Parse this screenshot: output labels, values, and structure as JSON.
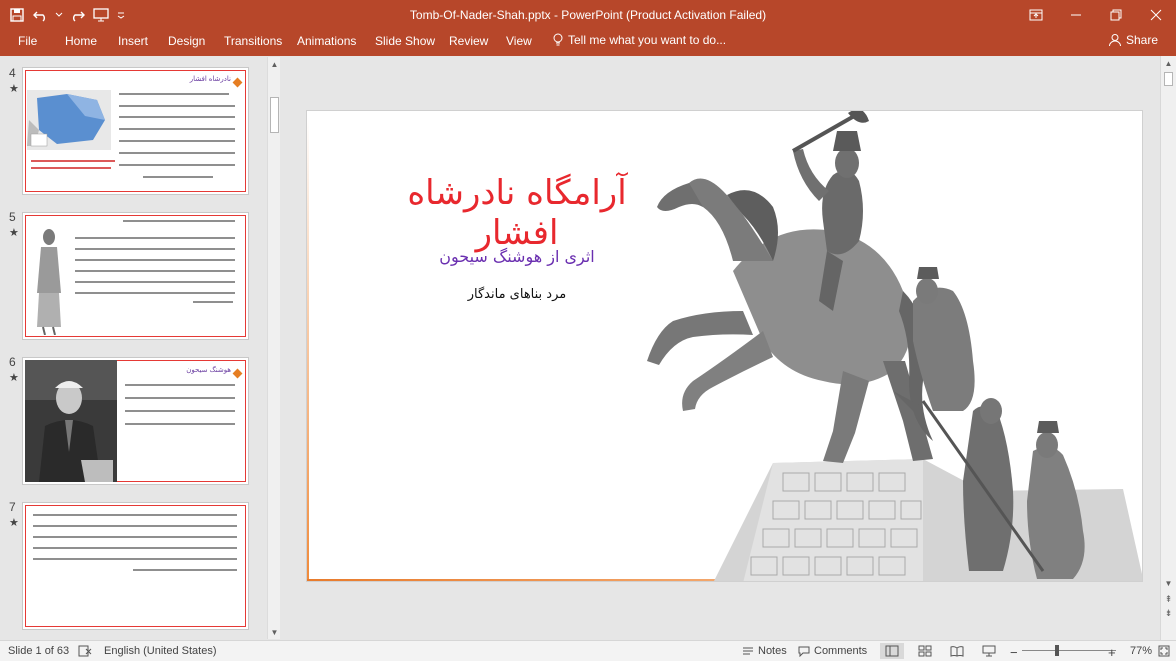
{
  "app": {
    "window_title": "Tomb-Of-Nader-Shah.pptx - PowerPoint (Product Activation Failed)",
    "accent_color": "#b7472a"
  },
  "ribbon": {
    "tabs": [
      "File",
      "Home",
      "Insert",
      "Design",
      "Transitions",
      "Animations",
      "Slide Show",
      "Review",
      "View"
    ],
    "tell_me": "Tell me what you want to do...",
    "share": "Share"
  },
  "thumbnails": [
    {
      "number": "4",
      "star": "★",
      "title": "نادرشاه افشار"
    },
    {
      "number": "5",
      "star": "★",
      "title": ""
    },
    {
      "number": "6",
      "star": "★",
      "title": "هوشنگ سیحون"
    },
    {
      "number": "7",
      "star": "★",
      "title": ""
    }
  ],
  "slide": {
    "title": "آرامگاه نادرشاه افشار",
    "subtitle": "اثری از هوشنگ سیحون",
    "tagline": "مرد بناهای ماندگار",
    "title_color": "#e8282e",
    "subtitle_color": "#6a2fb0"
  },
  "statusbar": {
    "slide_info": "Slide 1 of 63",
    "language": "English (United States)",
    "notes": "Notes",
    "comments": "Comments",
    "zoom": "77%",
    "zoom_level": 0.77
  }
}
